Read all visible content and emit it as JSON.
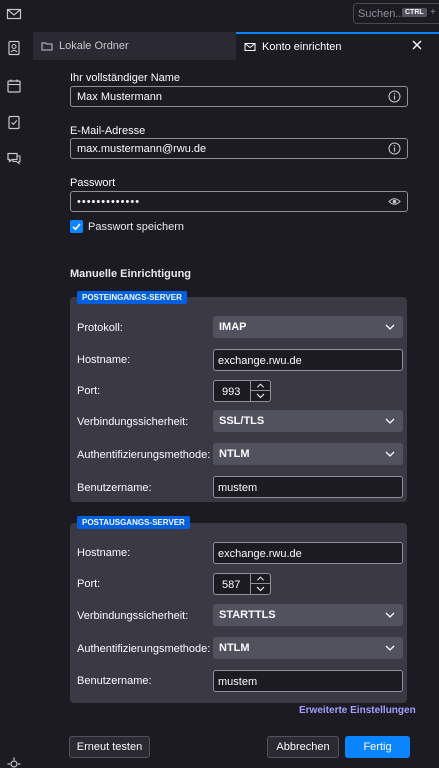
{
  "search": {
    "placeholder": "Suchen...",
    "shortcut_key": "CTRL",
    "shortcut_plus": "+"
  },
  "spaces": {
    "items": [
      "mail-icon",
      "address-book-icon",
      "calendar-icon",
      "tasks-icon",
      "chat-icon",
      "settings-icon"
    ]
  },
  "tabs": [
    {
      "label": "Lokale Ordner",
      "icon": "folder-icon"
    },
    {
      "label": "Konto einrichten",
      "icon": "mail-icon"
    }
  ],
  "form": {
    "name_label": "Ihr vollständiger Name",
    "name_value": "Max Mustermann",
    "email_label": "E-Mail-Adresse",
    "email_value": "max.mustermann@rwu.de",
    "password_label": "Passwort",
    "password_value": "•••••••••••••",
    "remember_label": "Passwort speichern",
    "remember_checked": true
  },
  "manual": {
    "title": "Manuelle Einrichtigung",
    "incoming": {
      "badge": "POSTEINGANGS-SERVER",
      "protocol_label": "Protokoll:",
      "protocol_value": "IMAP",
      "hostname_label": "Hostname:",
      "hostname_value": "exchange.rwu.de",
      "port_label": "Port:",
      "port_value": "993",
      "security_label": "Verbindungssicherheit:",
      "security_value": "SSL/TLS",
      "auth_label": "Authentifizierungsmethode:",
      "auth_value": "NTLM",
      "username_label": "Benutzername:",
      "username_value": "mustem"
    },
    "outgoing": {
      "badge": "POSTAUSGANGS-SERVER",
      "hostname_label": "Hostname:",
      "hostname_value": "exchange.rwu.de",
      "port_label": "Port:",
      "port_value": "587",
      "security_label": "Verbindungssicherheit:",
      "security_value": "STARTTLS",
      "auth_label": "Authentifizierungsmethode:",
      "auth_value": "NTLM",
      "username_label": "Benutzername:",
      "username_value": "mustem"
    },
    "advanced_link": "Erweiterte Einstellungen"
  },
  "buttons": {
    "retest": "Erneut testen",
    "cancel": "Abbrechen",
    "done": "Fertig"
  },
  "colors": {
    "accent": "#0a84ff",
    "badge": "#0060df",
    "link": "#a39eff",
    "panel": "#3a3944"
  }
}
